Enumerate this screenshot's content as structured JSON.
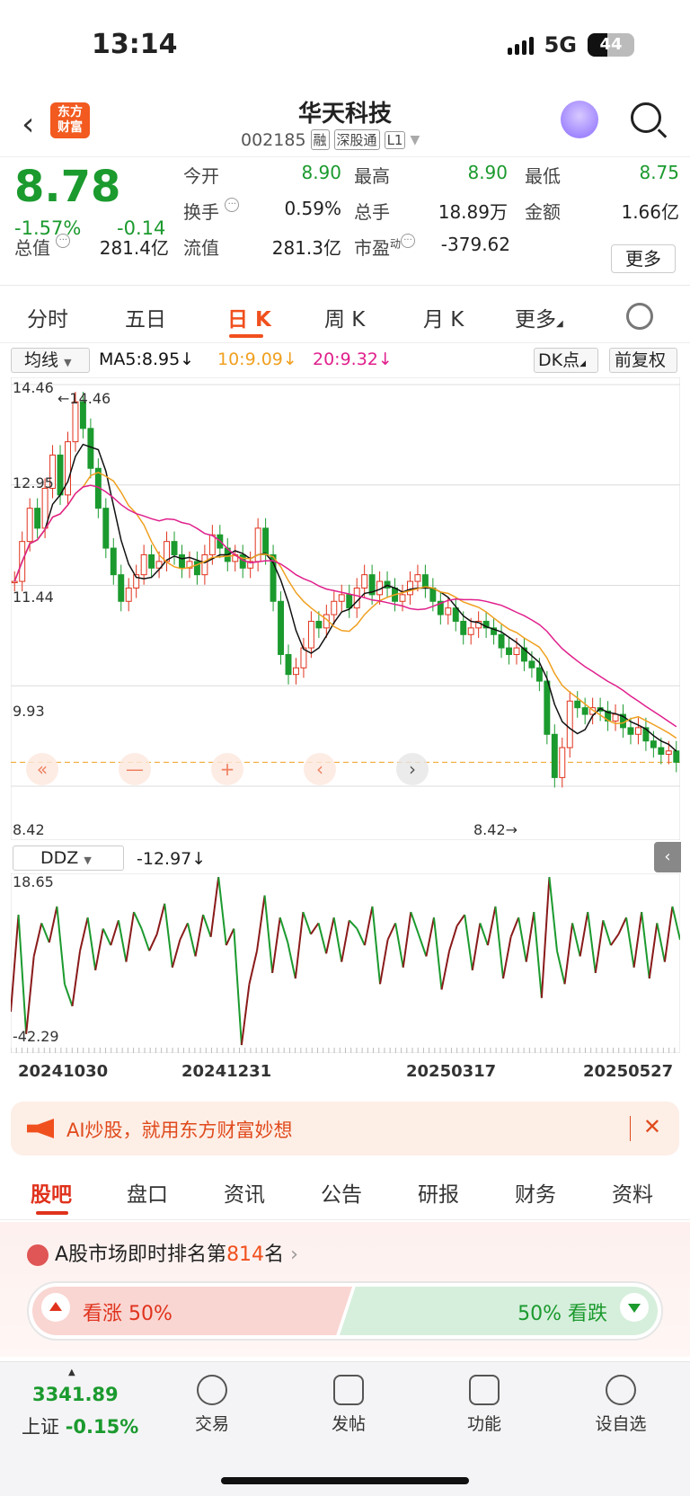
{
  "status": {
    "time": "13:14",
    "network": "5G",
    "battery": "44"
  },
  "nav": {
    "logo": "东方财富",
    "stock_name": "华天科技",
    "stock_code": "002185",
    "tags": [
      "融",
      "深股通",
      "L1"
    ]
  },
  "quote": {
    "price": "8.78",
    "change_pct": "-1.57%",
    "change": "-0.14",
    "fields": {
      "open_label": "今开",
      "open": "8.90",
      "high_label": "最高",
      "high": "8.90",
      "low_label": "最低",
      "low": "8.75",
      "turnover_label": "换手",
      "turnover": "0.59%",
      "volume_label": "总手",
      "volume": "18.89万",
      "amount_label": "金额",
      "amount": "1.66亿",
      "mktcap_label": "总值",
      "mktcap": "281.4亿",
      "float_label": "流值",
      "float": "281.3亿",
      "pe_label": "市盈",
      "pe_sup": "动",
      "pe": "-379.62"
    },
    "more_button": "更多"
  },
  "period_tabs": [
    "分时",
    "五日",
    "日 K",
    "周 K",
    "月 K",
    "更多"
  ],
  "active_period": "日 K",
  "ma_bar": {
    "selector": "均线",
    "ma5": "MA5:8.95↓",
    "ma10": "10:9.09↓",
    "ma20": "20:9.32↓",
    "dk_button": "DK点",
    "adjust_button": "前复权"
  },
  "colors": {
    "up": "#e0321c",
    "down": "#1b9a2e",
    "accent": "#f0501e",
    "ma5": "#111111",
    "ma10": "#f0a020",
    "ma20": "#e0208c"
  },
  "chart_data": [
    {
      "type": "candlestick",
      "y_ticks": [
        "14.46",
        "12.95",
        "11.44",
        "9.93",
        "8.42"
      ],
      "ylim": [
        8.42,
        14.46
      ],
      "max_label": "14.46",
      "min_label": "8.42",
      "close": [
        11.5,
        12.1,
        12.6,
        12.3,
        12.9,
        13.4,
        12.8,
        13.6,
        14.2,
        13.8,
        13.2,
        12.6,
        12.0,
        11.6,
        11.2,
        11.4,
        11.6,
        11.9,
        11.7,
        11.8,
        12.1,
        11.9,
        11.7,
        11.8,
        11.6,
        11.9,
        12.2,
        12.0,
        11.8,
        11.9,
        11.7,
        11.8,
        12.3,
        11.9,
        11.2,
        10.4,
        10.1,
        10.2,
        10.5,
        10.9,
        10.8,
        11.0,
        11.2,
        11.3,
        11.1,
        11.4,
        11.6,
        11.3,
        11.5,
        11.4,
        11.2,
        11.3,
        11.5,
        11.6,
        11.4,
        11.2,
        11.0,
        11.1,
        10.9,
        10.7,
        10.8,
        10.9,
        10.8,
        10.7,
        10.5,
        10.4,
        10.5,
        10.3,
        10.2,
        10.0,
        9.2,
        8.55,
        9.0,
        9.7,
        9.6,
        9.5,
        9.6,
        9.55,
        9.4,
        9.5,
        9.3,
        9.2,
        9.3,
        9.1,
        9.0,
        8.9,
        8.95,
        8.78
      ],
      "ma5": "MA5:8.95",
      "ma10": "10:9.09",
      "ma20": "20:9.32"
    },
    {
      "type": "line",
      "name": "DDZ",
      "value_label": "-12.97↓",
      "ylim": [
        -42.29,
        18.65
      ],
      "y_ticks": [
        "18.65",
        "-42.29"
      ],
      "x_ticks": [
        "20241030",
        "20241231",
        "20250317",
        "20250527"
      ],
      "values": [
        -30,
        5,
        -38,
        -10,
        2,
        -5,
        8,
        -20,
        -28,
        -8,
        4,
        -15,
        0,
        -6,
        3,
        -12,
        6,
        0,
        -8,
        -2,
        9,
        -14,
        -4,
        2,
        -10,
        5,
        -3,
        18.6,
        -6,
        0,
        -42,
        -20,
        -8,
        12,
        -16,
        4,
        -5,
        -18,
        6,
        -2,
        2,
        -9,
        4,
        -12,
        3,
        0,
        -6,
        8,
        -20,
        -4,
        2,
        -14,
        6,
        -2,
        -10,
        4,
        -22,
        -8,
        1,
        5,
        -15,
        2,
        -6,
        8,
        -18,
        -3,
        4,
        -12,
        6,
        -25,
        18.6,
        -8,
        -20,
        2,
        -10,
        6,
        -16,
        3,
        -6,
        -2,
        4,
        -14,
        6,
        -18,
        2,
        -12,
        8,
        -4
      ]
    }
  ],
  "ai_banner": "AI炒股，就用东方财富妙想",
  "sub_tabs": [
    "股吧",
    "盘口",
    "资讯",
    "公告",
    "研报",
    "财务",
    "资料"
  ],
  "rank": {
    "prefix": "A股市场即时排名第",
    "num": "814",
    "suffix": "名"
  },
  "vote": {
    "up": "看涨 50%",
    "down": "50% 看跌",
    "up_pct": 50,
    "down_pct": 50
  },
  "bottom": {
    "index_value": "3341.89",
    "index_name": "上证",
    "index_change": "-0.15%",
    "items": [
      "交易",
      "发帖",
      "功能",
      "设自选"
    ]
  }
}
